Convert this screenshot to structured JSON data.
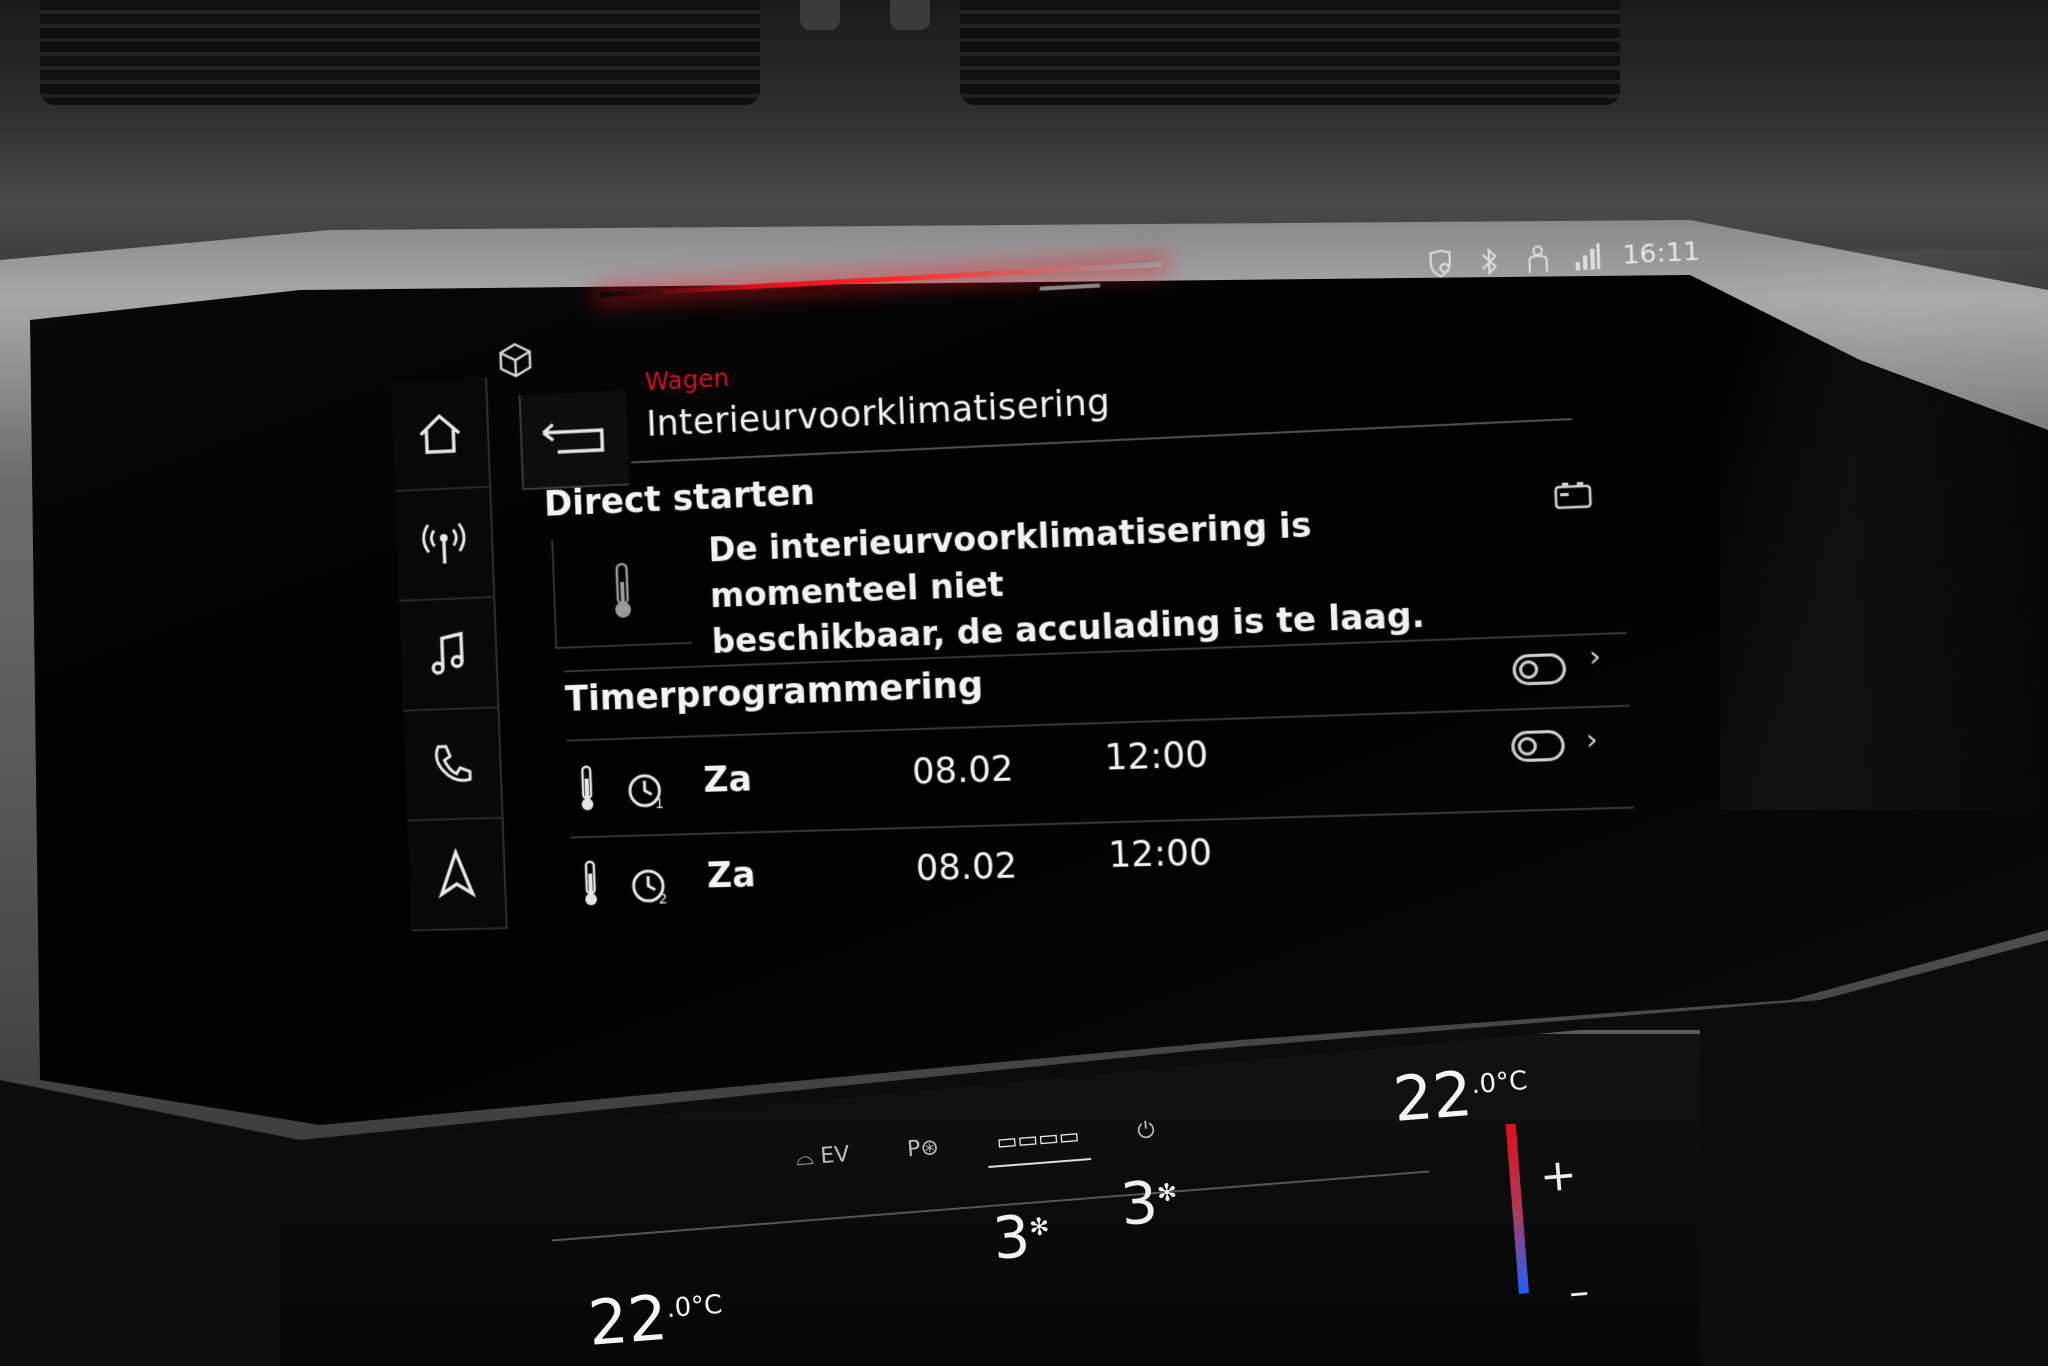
{
  "status": {
    "time": "16:11",
    "icons": [
      "shield-location-icon",
      "bluetooth-icon",
      "person-icon",
      "signal-icon"
    ]
  },
  "nav": {
    "breadcrumb": "Wagen",
    "title": "Interieurvoorklimatisering"
  },
  "sidebar": {
    "items": [
      {
        "icon": "home-icon"
      },
      {
        "icon": "radio-icon"
      },
      {
        "icon": "music-icon"
      },
      {
        "icon": "phone-icon"
      },
      {
        "icon": "navigation-icon"
      }
    ]
  },
  "direct_start": {
    "title": "Direct starten",
    "message_line1": "De interieurvoorklimatisering is momenteel niet",
    "message_line2": "beschikbaar, de acculading is te laag."
  },
  "timer": {
    "title": "Timerprogrammering",
    "enabled": false,
    "rows": [
      {
        "timer_no": "1",
        "day": "Za",
        "date": "08.02",
        "time": "12:00",
        "enabled": false
      },
      {
        "timer_no": "2",
        "day": "Za",
        "date": "08.02",
        "time": "12:00",
        "enabled": false
      }
    ]
  },
  "climate": {
    "tabs": [
      "EV",
      "P",
      "",
      ""
    ],
    "left_temp": "22",
    "left_temp_dec": ".0",
    "right_temp": "22",
    "right_temp_dec": ".0",
    "unit": "°C",
    "fan_left": "3",
    "fan_right": "3",
    "plus": "+",
    "minus": "–"
  },
  "colors": {
    "accent_red": "#d4101c",
    "text": "#f2f2f2",
    "background": "#000000"
  }
}
